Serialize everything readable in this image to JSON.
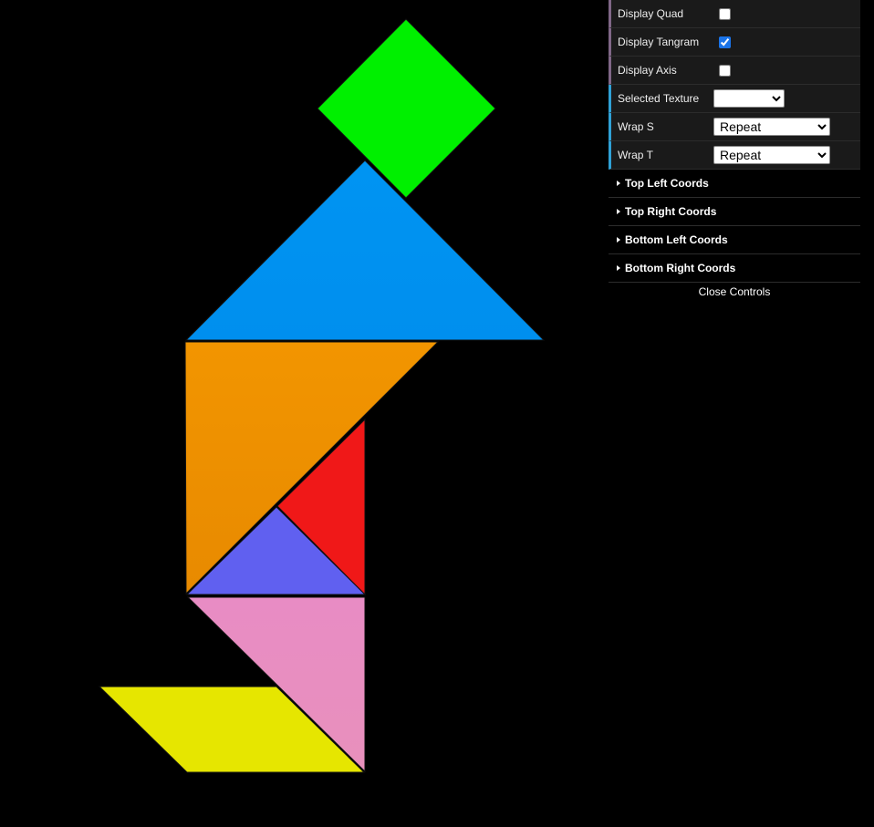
{
  "controls": {
    "rows": [
      {
        "id": "display-quad",
        "label": "Display Quad",
        "type": "checkbox",
        "checked": false
      },
      {
        "id": "display-tangram",
        "label": "Display Tangram",
        "type": "checkbox",
        "checked": true
      },
      {
        "id": "display-axis",
        "label": "Display Axis",
        "type": "checkbox",
        "checked": false
      },
      {
        "id": "selected-texture",
        "label": "Selected Texture",
        "type": "select",
        "value": ""
      },
      {
        "id": "wrap-s",
        "label": "Wrap S",
        "type": "select",
        "value": "Repeat"
      },
      {
        "id": "wrap-t",
        "label": "Wrap T",
        "type": "select",
        "value": "Repeat"
      }
    ],
    "folders": [
      "Top Left Coords",
      "Top Right Coords",
      "Bottom Left Coords",
      "Bottom Right Coords"
    ],
    "close_label": "Close Controls"
  },
  "tangram": {
    "piece_colors": {
      "square": "#00f000",
      "large_triangle_blue": "#0090f0",
      "large_triangle_orange": "#f09000",
      "small_triangle_red": "#f01818",
      "small_triangle_purple": "#6060f0",
      "medium_triangle_pink": "#f090c0",
      "parallelogram": "#f0f000"
    }
  }
}
